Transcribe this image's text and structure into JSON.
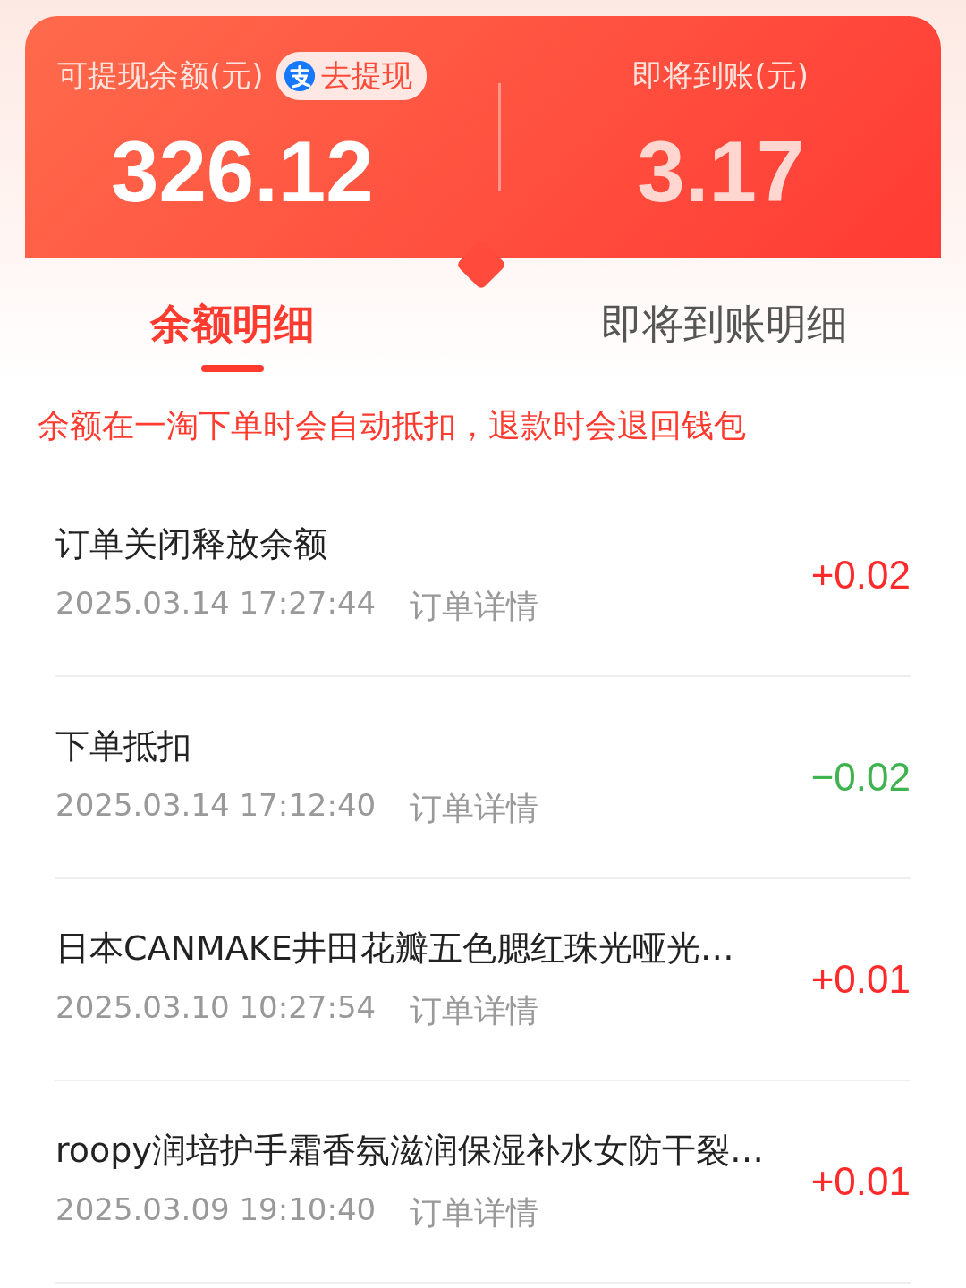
{
  "balance_card": {
    "withdrawable": {
      "label": "可提现余额(元)",
      "action": "去提现",
      "amount": "326.12"
    },
    "pending": {
      "label": "即将到账(元)",
      "amount": "3.17"
    }
  },
  "tabs": [
    {
      "label": "余额明细",
      "selected": true
    },
    {
      "label": "即将到账明细",
      "selected": false
    }
  ],
  "notice": "余额在一淘下单时会自动抵扣，退款时会退回钱包",
  "records": [
    {
      "title": "订单关闭释放余额",
      "time": "2025.03.14 17:27:44",
      "link": "订单详情",
      "amount": "+0.02",
      "kind": "credit"
    },
    {
      "title": "下单抵扣",
      "time": "2025.03.14 17:12:40",
      "link": "订单详情",
      "amount": "−0.02",
      "kind": "debit"
    },
    {
      "title": "日本CANMAKE井田花瓣五色腮红珠光哑光…",
      "time": "2025.03.10 10:27:54",
      "link": "订单详情",
      "amount": "+0.01",
      "kind": "credit"
    },
    {
      "title": "roopy润培护手霜香氛滋润保湿补水女防干裂…",
      "time": "2025.03.09 19:10:40",
      "link": "订单详情",
      "amount": "+0.01",
      "kind": "credit"
    }
  ]
}
